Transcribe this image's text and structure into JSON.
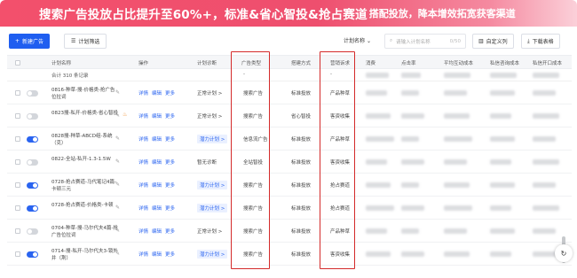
{
  "banner": {
    "headline": "搜索广告投放占比提升至60%+，标准&省心智投&抢占赛道",
    "tail": "搭配投放，降本增效拓宽获客渠道"
  },
  "toolbar": {
    "new_label": "新建广告",
    "filter_label": "计划筛选",
    "select_label": "计划名称",
    "search_placeholder": "请输入计划名称",
    "search_count": "0/50",
    "columns_label": "自定义列",
    "download_label": "下载表格"
  },
  "columns": {
    "name": "计划名称",
    "ops": "操作",
    "diag": "计划诊断",
    "adtype": "广告类型",
    "mode": "搭建方式",
    "goal": "营销诉求",
    "cost": "消费",
    "clicks": "点击率",
    "avg": "平均互动成本",
    "msg": "私信咨询成本",
    "open": "私信开口成本"
  },
  "summary": {
    "label": "合计 310 条记录",
    "dash1": "-",
    "dash2": "-"
  },
  "rows": [
    {
      "name": "0816-种草-搜-价格类-抢广告位拉词",
      "ops": [
        "详情",
        "编辑",
        "更多"
      ],
      "diag": "正常计划 >",
      "diag_tag": false,
      "adtype": "搜索广告",
      "mode": "标准投放",
      "goal": "产品种草",
      "on": false
    },
    {
      "name": "0823搜-私开-价格类-省心智投",
      "ops": [
        "详情",
        "编辑",
        "更多"
      ],
      "diag": "正常计划 >",
      "diag_tag": false,
      "adtype": "搜索广告",
      "mode": "省心智投",
      "goal": "客资收集",
      "on": false
    },
    {
      "name": "0828搜-种草-ABCD组-系统（克）",
      "ops": [
        "详情",
        "编辑",
        "更多"
      ],
      "diag": "潜力计划 >",
      "diag_tag": true,
      "adtype": "信息流广告",
      "mode": "标准投放",
      "goal": "产品种草",
      "on": true
    },
    {
      "name": "0822-全站-私开-1.3-1.5W",
      "ops": [
        "详情",
        "编辑",
        "更多"
      ],
      "diag": "暂无诊断",
      "diag_tag": false,
      "adtype": "全站智投",
      "mode": "标准投放",
      "goal": "客资收集",
      "on": false
    },
    {
      "name": "0728-抢占赛道-马代笔记4篇-卡顿三元",
      "ops": [
        "详情",
        "编辑",
        "更多"
      ],
      "diag": "潜力计划 >",
      "diag_tag": true,
      "adtype": "搜索广告",
      "mode": "标准投放",
      "goal": "抢占赛道",
      "on": true
    },
    {
      "name": "0728-抢占赛道-价格类-卡顿",
      "ops": [
        "详情",
        "编辑",
        "更多"
      ],
      "diag": "潜力计划 >",
      "diag_tag": true,
      "adtype": "搜索广告",
      "mode": "标准投放",
      "goal": "抢占赛道",
      "on": true
    },
    {
      "name": "0704-种草-搜-马尔代夫4篇-抢广告位拉词",
      "ops": [
        "详情",
        "编辑",
        "更多"
      ],
      "diag": "正常计划 >",
      "diag_tag": false,
      "adtype": "搜索广告",
      "mode": "标准投放",
      "goal": "产品种草",
      "on": false
    },
    {
      "name": "0714-搜-私开-马尔代夫3-锁外井（荆）",
      "ops": [
        "详情",
        "编辑",
        "更多"
      ],
      "diag": "潜力计划 >",
      "diag_tag": true,
      "adtype": "搜索广告",
      "mode": "标准投放",
      "goal": "客资收集",
      "on": true
    }
  ]
}
